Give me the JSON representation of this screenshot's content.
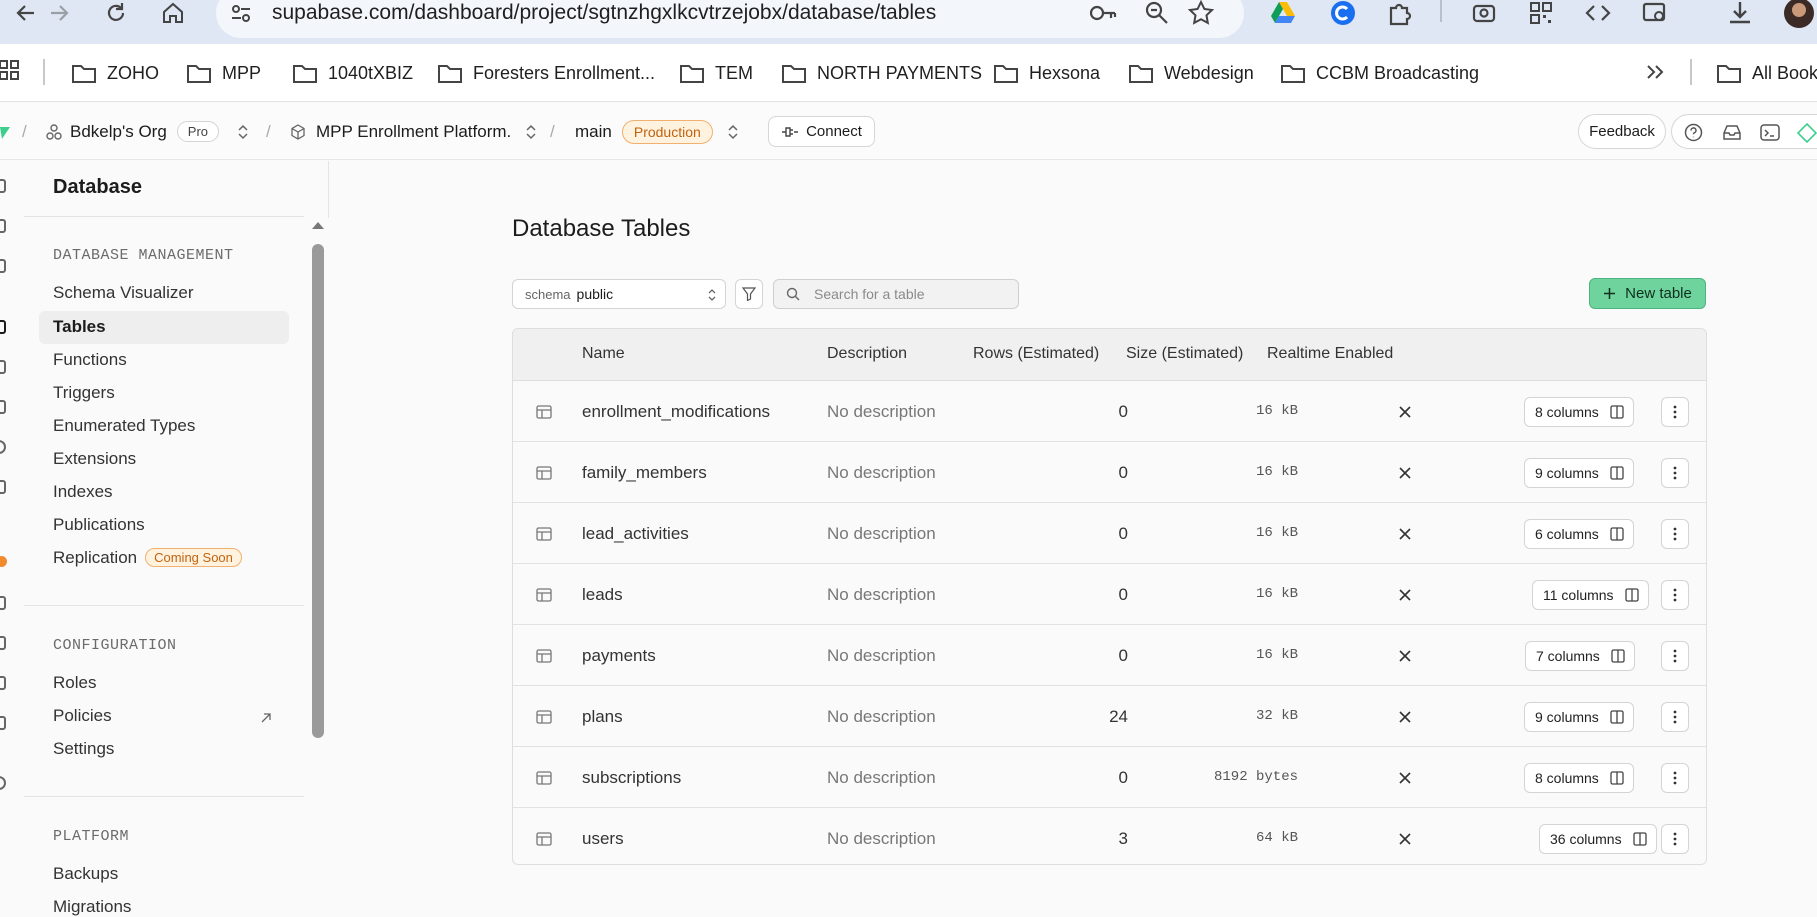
{
  "browser": {
    "url": "supabase.com/dashboard/project/sgtnzhgxlkcvtrzejobx/database/tables",
    "bookmarks": [
      {
        "label": "ZOHO"
      },
      {
        "label": "MPP"
      },
      {
        "label": "1040tXBIZ"
      },
      {
        "label": "Foresters Enrollment..."
      },
      {
        "label": "TEM"
      },
      {
        "label": "NORTH PAYMENTS"
      },
      {
        "label": "Hexsona"
      },
      {
        "label": "Webdesign"
      },
      {
        "label": "CCBM Broadcasting"
      }
    ],
    "all_bookmarks": "All Book"
  },
  "appbar": {
    "org": "Bdkelp's Org",
    "plan": "Pro",
    "project": "MPP Enrollment Platform.",
    "branch": "main",
    "env": "Production",
    "connect": "Connect",
    "feedback": "Feedback"
  },
  "sidebar": {
    "title": "Database",
    "sections": [
      {
        "heading": "DATABASE MANAGEMENT"
      },
      {
        "heading": "CONFIGURATION"
      },
      {
        "heading": "PLATFORM"
      }
    ],
    "management_items": [
      "Schema Visualizer",
      "Tables",
      "Functions",
      "Triggers",
      "Enumerated Types",
      "Extensions",
      "Indexes",
      "Publications",
      "Replication"
    ],
    "replication_badge": "Coming Soon",
    "configuration_items": [
      "Roles",
      "Policies",
      "Settings"
    ],
    "platform_items": [
      "Backups",
      "Migrations"
    ]
  },
  "main": {
    "title": "Database Tables",
    "schema_label": "schema",
    "schema_value": "public",
    "search_placeholder": "Search for a table",
    "new_table": "New table",
    "columns": [
      "Name",
      "Description",
      "Rows (Estimated)",
      "Size (Estimated)",
      "Realtime Enabled"
    ],
    "rows": [
      {
        "name": "enrollment_modifications",
        "description": "No description",
        "rows": "0",
        "size": "16 kB",
        "columns": "8 columns"
      },
      {
        "name": "family_members",
        "description": "No description",
        "rows": "0",
        "size": "16 kB",
        "columns": "9 columns"
      },
      {
        "name": "lead_activities",
        "description": "No description",
        "rows": "0",
        "size": "16 kB",
        "columns": "6 columns"
      },
      {
        "name": "leads",
        "description": "No description",
        "rows": "0",
        "size": "16 kB",
        "columns": "11 columns"
      },
      {
        "name": "payments",
        "description": "No description",
        "rows": "0",
        "size": "16 kB",
        "columns": "7 columns"
      },
      {
        "name": "plans",
        "description": "No description",
        "rows": "24",
        "size": "32 kB",
        "columns": "9 columns"
      },
      {
        "name": "subscriptions",
        "description": "No description",
        "rows": "0",
        "size": "8192 bytes",
        "columns": "8 columns"
      },
      {
        "name": "users",
        "description": "No description",
        "rows": "3",
        "size": "64 kB",
        "columns": "36 columns"
      }
    ]
  },
  "colors": {
    "accent_green": "#6ed39c",
    "production_orange": "#c2620d"
  }
}
